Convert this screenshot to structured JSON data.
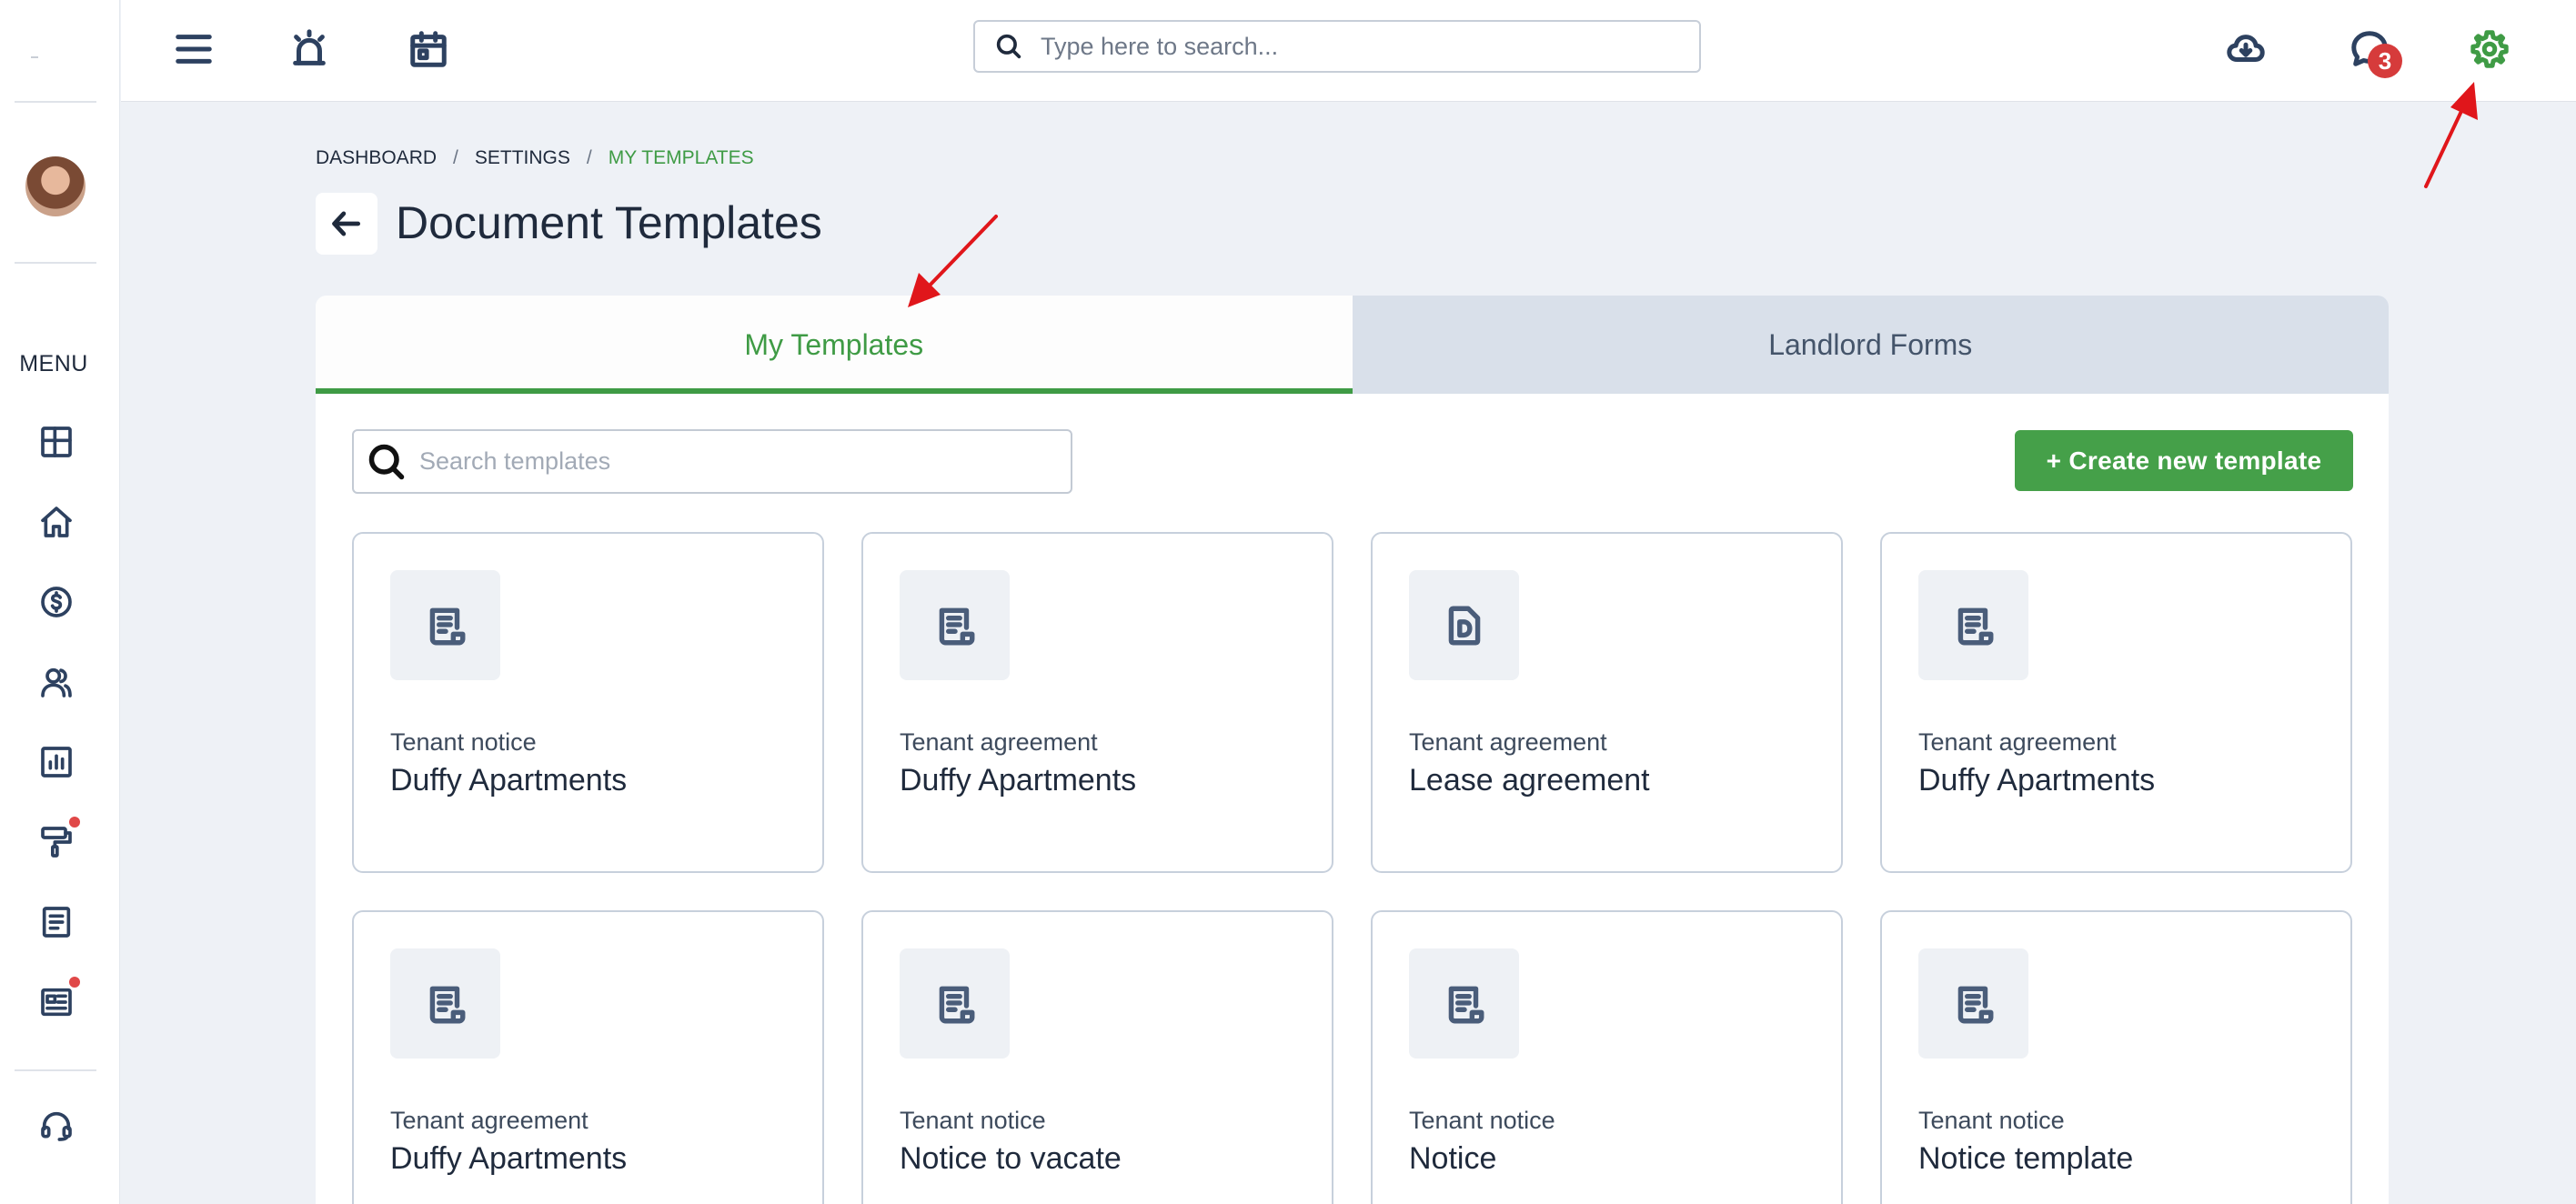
{
  "header": {
    "search_placeholder": "Type here to search...",
    "notification_count": "3"
  },
  "sidebar": {
    "menu_label": "MENU",
    "items": [
      {
        "icon": "dashboard-icon"
      },
      {
        "icon": "home-icon"
      },
      {
        "icon": "dollar-icon"
      },
      {
        "icon": "users-icon"
      },
      {
        "icon": "reports-icon"
      },
      {
        "icon": "paint-roller-icon"
      },
      {
        "icon": "document-icon"
      },
      {
        "icon": "newspaper-icon"
      },
      {
        "icon": "headset-icon"
      }
    ]
  },
  "breadcrumb": {
    "items": [
      "DASHBOARD",
      "SETTINGS",
      "MY TEMPLATES"
    ],
    "separator": "/"
  },
  "page": {
    "title": "Document Templates"
  },
  "tabs": [
    {
      "label": "My Templates",
      "active": true
    },
    {
      "label": "Landlord Forms",
      "active": false
    }
  ],
  "templates": {
    "search_placeholder": "Search templates",
    "create_button": "+ Create new template",
    "cards": [
      {
        "category": "Tenant notice",
        "name": "Duffy Apartments",
        "icon": "document-icon"
      },
      {
        "category": "Tenant agreement",
        "name": "Duffy Apartments",
        "icon": "document-icon"
      },
      {
        "category": "Tenant agreement",
        "name": "Lease agreement",
        "icon": "pdf-document-icon"
      },
      {
        "category": "Tenant agreement",
        "name": "Duffy Apartments",
        "icon": "document-icon"
      },
      {
        "category": "Tenant agreement",
        "name": "Duffy Apartments",
        "icon": "document-icon"
      },
      {
        "category": "Tenant notice",
        "name": "Notice to vacate",
        "icon": "document-icon"
      },
      {
        "category": "Tenant notice",
        "name": "Notice",
        "icon": "document-icon"
      },
      {
        "category": "Tenant notice",
        "name": "Notice template",
        "icon": "document-icon"
      }
    ]
  },
  "colors": {
    "accent": "#3f9b45",
    "annotation_arrow": "#e0161b",
    "badge": "#d63b3b"
  }
}
